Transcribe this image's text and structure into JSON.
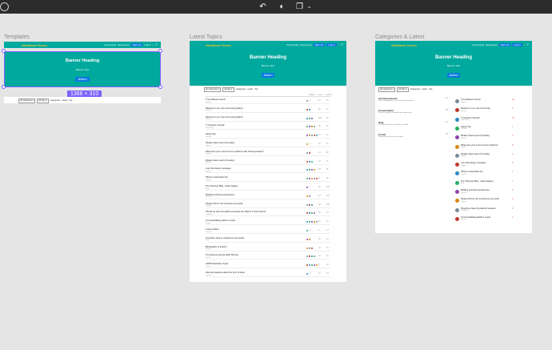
{
  "toolbar": {
    "icons": [
      "circle-outline",
      "undo",
      "theme-toggle",
      "layers",
      "chevron-down"
    ]
  },
  "frames": {
    "templates": {
      "title": "Templates"
    },
    "latest": {
      "title": "Latest Topics"
    },
    "categories": {
      "title": "Categories & Latest"
    }
  },
  "site": {
    "logo": "SiteName Forum",
    "header_links": [
      "Community",
      "Resources"
    ],
    "signup": "Sign Up",
    "login": "Log In"
  },
  "banner": {
    "heading": "Banner Heading",
    "subtext": "Banner Text",
    "action": "Action"
  },
  "selection": {
    "dimensions": "1366 × 310"
  },
  "nav": {
    "boxes": [
      "all categories ▾",
      "all tags ▾"
    ],
    "links": [
      "Categories",
      "Latest",
      "Top"
    ]
  },
  "table_headers": {
    "replies": "Replies",
    "views": "Views",
    "activity": "Activity"
  },
  "latest_topics": [
    {
      "title": "© FreshNews Launch",
      "cat": "Updates",
      "replies": "0",
      "views": "12",
      "activity": "5m"
    },
    {
      "title": "Welcome to our new community platform",
      "cat": "General",
      "replies": "4",
      "views": "30",
      "activity": "1h"
    },
    {
      "title": "Welcome to our new community platform",
      "cat": "General",
      "replies": "2",
      "views": "208",
      "activity": "2h"
    },
    {
      "title": "© Introduce Yourself",
      "cat": "Community",
      "replies": "12",
      "views": "90",
      "activity": "3h"
    },
    {
      "title": "Happy Tag",
      "cat": "General",
      "replies": "1",
      "views": "14",
      "activity": "4h"
    },
    {
      "title": "Weekly status report (Tuesday)",
      "cat": "Reports",
      "replies": "3",
      "views": "22",
      "activity": "5h"
    },
    {
      "title": "What were your most common problems after finding answers?",
      "cat": "Support",
      "replies": "6",
      "views": "41",
      "activity": "6h"
    },
    {
      "title": "Weekly status report (Tuesday)",
      "cat": "Reports",
      "replies": "2",
      "views": "19",
      "activity": "7h"
    },
    {
      "title": "Lost chat design messages",
      "cat": "Support",
      "replies": "5",
      "views": "33",
      "activity": "8h"
    },
    {
      "title": "Where is Gas Meter box",
      "cat": "General",
      "replies": "1",
      "views": "11",
      "activity": "9h"
    },
    {
      "title": "The Volunteer Blog - whats happen",
      "cat": "Blog",
      "replies": "7",
      "views": "52",
      "activity": "10h"
    },
    {
      "title": "Building and friend preferences",
      "cat": "General",
      "replies": "3",
      "views": "27",
      "activity": "11h"
    },
    {
      "title": "Please find the rest of product you prefer",
      "cat": "Support",
      "replies": "2",
      "views": "18",
      "activity": "12h"
    },
    {
      "title": "Should we have the platform because the OS(A)? is there behind",
      "cat": "Feedback",
      "replies": "9",
      "views": "64",
      "activity": "1d"
    },
    {
      "title": "UI Consolidating platform needs",
      "cat": "Design",
      "replies": "1",
      "views": "10",
      "activity": "1d"
    },
    {
      "title": "Cross-product",
      "cat": "General",
      "replies": "0",
      "views": "6",
      "activity": "1d"
    },
    {
      "title": "Innovation easy to maintain for the people",
      "cat": "Ideas",
      "replies": "4",
      "views": "29",
      "activity": "2d"
    },
    {
      "title": "Bibliography of authors",
      "cat": "Library",
      "replies": "2",
      "views": "15",
      "activity": "2d"
    },
    {
      "title": "The Discover Europe 2020 Winners",
      "cat": "Events",
      "replies": "3",
      "views": "24",
      "activity": "2d"
    },
    {
      "title": "GDPR Newsletter Topics",
      "cat": "Legal",
      "replies": "1",
      "views": "9",
      "activity": "3d"
    },
    {
      "title": "Peer-led questions about the form of factor",
      "cat": "General",
      "replies": "5",
      "views": "37",
      "activity": "3d"
    }
  ],
  "categories_list": [
    {
      "title": "Announcements",
      "desc": "News and updates from the Community Team",
      "count": "12"
    },
    {
      "title": "Conversation",
      "desc": "Discuss anything related to the community",
      "count": "48"
    },
    {
      "title": "Help",
      "desc": "Get help from the community and staff",
      "count": "31"
    },
    {
      "title": "Forum",
      "desc": "General discussion for everyone",
      "count": "26"
    }
  ],
  "categories_latest": [
    {
      "title": "© FreshNews Launch",
      "cat": "Updates",
      "count": "12"
    },
    {
      "title": "Welcome to our new community",
      "cat": "General",
      "count": "4"
    },
    {
      "title": "© Introduce Yourself",
      "cat": "Community",
      "count": "27"
    },
    {
      "title": "Happy Tag",
      "cat": "General",
      "count": "1"
    },
    {
      "title": "Weekly status report (Tuesday)",
      "cat": "Reports",
      "count": "3"
    },
    {
      "title": "What were your most common problems",
      "cat": "Support",
      "count": "6"
    },
    {
      "title": "Weekly status report (Tuesday)",
      "cat": "Reports",
      "count": "2"
    },
    {
      "title": "Lost chat design messages",
      "cat": "Support",
      "count": "5"
    },
    {
      "title": "Where is Gas Meter box",
      "cat": "General",
      "count": "1"
    },
    {
      "title": "The Volunteer Blog - whats happen",
      "cat": "Blog",
      "count": "7"
    },
    {
      "title": "Building and friend preferences",
      "cat": "General",
      "count": "3"
    },
    {
      "title": "Please find the rest of products you prefer",
      "cat": "Support",
      "count": "2"
    },
    {
      "title": "Should we have the platform because",
      "cat": "Feedback",
      "count": "9"
    },
    {
      "title": "UI Consolidating platform needs",
      "cat": "Design",
      "count": "1"
    }
  ],
  "colors": {
    "brand": "#00a99d",
    "button": "#0a78e0",
    "selection": "#7b61ff",
    "logo": "#f4c430"
  }
}
